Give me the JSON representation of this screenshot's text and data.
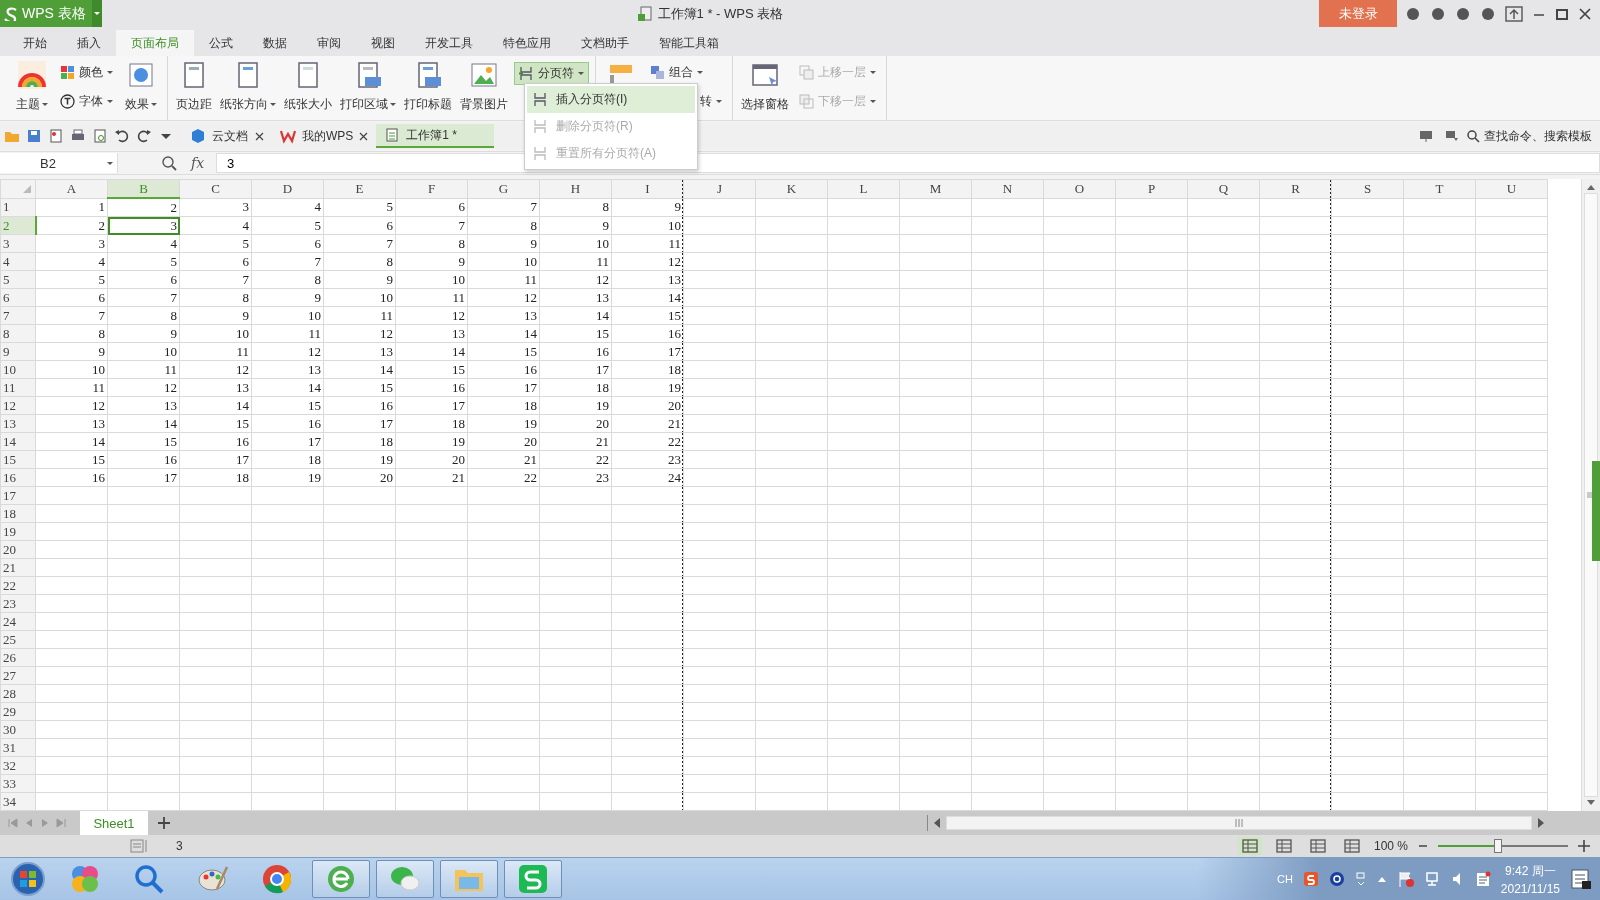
{
  "app_button": {
    "label": "WPS 表格"
  },
  "window": {
    "title": "工作簿1 * - WPS 表格"
  },
  "login_button": {
    "label": "未登录"
  },
  "ribbon_tabs": [
    {
      "label": "开始",
      "selected": false
    },
    {
      "label": "插入",
      "selected": false
    },
    {
      "label": "页面布局",
      "selected": true
    },
    {
      "label": "公式",
      "selected": false
    },
    {
      "label": "数据",
      "selected": false
    },
    {
      "label": "审阅",
      "selected": false
    },
    {
      "label": "视图",
      "selected": false
    },
    {
      "label": "开发工具",
      "selected": false
    },
    {
      "label": "特色应用",
      "selected": false
    },
    {
      "label": "文档助手",
      "selected": false
    },
    {
      "label": "智能工具箱",
      "selected": false
    }
  ],
  "ribbon": {
    "groups": [
      {
        "items": [
          {
            "kind": "large",
            "label": "主题",
            "dropdown": true
          },
          {
            "kind": "stack",
            "items": [
              {
                "label": "颜色",
                "dropdown": true,
                "disabled": false
              },
              {
                "label": "字体",
                "dropdown": true,
                "disabled": false
              }
            ]
          },
          {
            "kind": "large",
            "label": "效果",
            "dropdown": true
          }
        ]
      },
      {
        "items": [
          {
            "kind": "large",
            "label": "页边距",
            "dropdown": false
          },
          {
            "kind": "large",
            "label": "纸张方向",
            "dropdown": true
          },
          {
            "kind": "large",
            "label": "纸张大小",
            "dropdown": false
          },
          {
            "kind": "large",
            "label": "打印区域",
            "dropdown": true
          },
          {
            "kind": "large",
            "label": "打印标题",
            "dropdown": false
          },
          {
            "kind": "large",
            "label": "背景图片",
            "dropdown": false
          },
          {
            "kind": "stack",
            "items": [
              {
                "label": "分页符",
                "dropdown": true,
                "disabled": false,
                "pressed": true
              }
            ]
          }
        ]
      },
      {
        "items": [
          {
            "kind": "large"
          },
          {
            "kind": "stack",
            "items": [
              {
                "label": "组合",
                "dropdown": true,
                "disabled": false
              },
              {
                "label": "转",
                "dropdown": true,
                "disabled": false,
                "covered": true
              }
            ]
          }
        ]
      },
      {
        "items": [
          {
            "kind": "large",
            "label": "选择窗格",
            "dropdown": false
          },
          {
            "kind": "stack",
            "items": [
              {
                "label": "上移一层",
                "dropdown": true,
                "disabled": true
              },
              {
                "label": "下移一层",
                "dropdown": true,
                "disabled": true
              }
            ]
          }
        ]
      }
    ]
  },
  "dropdown_menu": {
    "items": [
      {
        "label": "插入分页符(I)",
        "disabled": false,
        "selected": true
      },
      {
        "label": "删除分页符(R)",
        "disabled": true,
        "selected": false
      },
      {
        "label": "重置所有分页符(A)",
        "disabled": true,
        "selected": false
      }
    ]
  },
  "doc_tabs": [
    {
      "label": "云文档",
      "closable": true,
      "selected": false
    },
    {
      "label": "我的WPS",
      "closable": true,
      "selected": false
    },
    {
      "label": "工作簿1 *",
      "closable": false,
      "selected": true
    }
  ],
  "search": {
    "label": "查找命令、搜索模板"
  },
  "formula_bar": {
    "name_box": "B2",
    "fx": "fx",
    "value": "3"
  },
  "sheet": {
    "columns": [
      {
        "label": "A",
        "selected": false,
        "page_break_after": false
      },
      {
        "label": "B",
        "selected": true,
        "page_break_after": false
      },
      {
        "label": "C",
        "selected": false,
        "page_break_after": false
      },
      {
        "label": "D",
        "selected": false,
        "page_break_after": false
      },
      {
        "label": "E",
        "selected": false,
        "page_break_after": false
      },
      {
        "label": "F",
        "selected": false,
        "page_break_after": false
      },
      {
        "label": "G",
        "selected": false,
        "page_break_after": false
      },
      {
        "label": "H",
        "selected": false,
        "page_break_after": false
      },
      {
        "label": "I",
        "selected": false,
        "page_break_after": true
      },
      {
        "label": "J",
        "selected": false,
        "page_break_after": false
      },
      {
        "label": "K",
        "selected": false,
        "page_break_after": false
      },
      {
        "label": "L",
        "selected": false,
        "page_break_after": false
      },
      {
        "label": "M",
        "selected": false,
        "page_break_after": false
      },
      {
        "label": "N",
        "selected": false,
        "page_break_after": false
      },
      {
        "label": "O",
        "selected": false,
        "page_break_after": false
      },
      {
        "label": "P",
        "selected": false,
        "page_break_after": false
      },
      {
        "label": "Q",
        "selected": false,
        "page_break_after": false
      },
      {
        "label": "R",
        "selected": false,
        "page_break_after": true
      },
      {
        "label": "S",
        "selected": false,
        "page_break_after": false
      },
      {
        "label": "T",
        "selected": false,
        "page_break_after": false
      },
      {
        "label": "U",
        "selected": false,
        "page_break_after": false
      }
    ],
    "rows": [
      {
        "header": "1",
        "selected": false,
        "cells": [
          "1",
          "2",
          "3",
          "4",
          "5",
          "6",
          "7",
          "8",
          "9"
        ]
      },
      {
        "header": "2",
        "selected": true,
        "cells": [
          "2",
          "3",
          "4",
          "5",
          "6",
          "7",
          "8",
          "9",
          "10"
        ]
      },
      {
        "header": "3",
        "selected": false,
        "cells": [
          "3",
          "4",
          "5",
          "6",
          "7",
          "8",
          "9",
          "10",
          "11"
        ]
      },
      {
        "header": "4",
        "selected": false,
        "cells": [
          "4",
          "5",
          "6",
          "7",
          "8",
          "9",
          "10",
          "11",
          "12"
        ]
      },
      {
        "header": "5",
        "selected": false,
        "cells": [
          "5",
          "6",
          "7",
          "8",
          "9",
          "10",
          "11",
          "12",
          "13"
        ]
      },
      {
        "header": "6",
        "selected": false,
        "cells": [
          "6",
          "7",
          "8",
          "9",
          "10",
          "11",
          "12",
          "13",
          "14"
        ]
      },
      {
        "header": "7",
        "selected": false,
        "cells": [
          "7",
          "8",
          "9",
          "10",
          "11",
          "12",
          "13",
          "14",
          "15"
        ]
      },
      {
        "header": "8",
        "selected": false,
        "cells": [
          "8",
          "9",
          "10",
          "11",
          "12",
          "13",
          "14",
          "15",
          "16"
        ]
      },
      {
        "header": "9",
        "selected": false,
        "cells": [
          "9",
          "10",
          "11",
          "12",
          "13",
          "14",
          "15",
          "16",
          "17"
        ]
      },
      {
        "header": "10",
        "selected": false,
        "cells": [
          "10",
          "11",
          "12",
          "13",
          "14",
          "15",
          "16",
          "17",
          "18"
        ]
      },
      {
        "header": "11",
        "selected": false,
        "cells": [
          "11",
          "12",
          "13",
          "14",
          "15",
          "16",
          "17",
          "18",
          "19"
        ]
      },
      {
        "header": "12",
        "selected": false,
        "cells": [
          "12",
          "13",
          "14",
          "15",
          "16",
          "17",
          "18",
          "19",
          "20"
        ]
      },
      {
        "header": "13",
        "selected": false,
        "cells": [
          "13",
          "14",
          "15",
          "16",
          "17",
          "18",
          "19",
          "20",
          "21"
        ]
      },
      {
        "header": "14",
        "selected": false,
        "cells": [
          "14",
          "15",
          "16",
          "17",
          "18",
          "19",
          "20",
          "21",
          "22"
        ]
      },
      {
        "header": "15",
        "selected": false,
        "cells": [
          "15",
          "16",
          "17",
          "18",
          "19",
          "20",
          "21",
          "22",
          "23"
        ]
      },
      {
        "header": "16",
        "selected": false,
        "cells": [
          "16",
          "17",
          "18",
          "19",
          "20",
          "21",
          "22",
          "23",
          "24"
        ]
      },
      {
        "header": "17",
        "selected": false
      },
      {
        "header": "18",
        "selected": false
      },
      {
        "header": "19",
        "selected": false
      },
      {
        "header": "20",
        "selected": false
      },
      {
        "header": "21",
        "selected": false
      },
      {
        "header": "22",
        "selected": false
      },
      {
        "header": "23",
        "selected": false
      },
      {
        "header": "24",
        "selected": false
      },
      {
        "header": "25",
        "selected": false
      },
      {
        "header": "26",
        "selected": false
      },
      {
        "header": "27",
        "selected": false
      },
      {
        "header": "28",
        "selected": false
      },
      {
        "header": "29",
        "selected": false
      },
      {
        "header": "30",
        "selected": false
      },
      {
        "header": "31",
        "selected": false
      },
      {
        "header": "32",
        "selected": false
      },
      {
        "header": "33",
        "selected": false
      },
      {
        "header": "34",
        "selected": false
      }
    ]
  },
  "sheet_tabs": [
    {
      "label": "Sheet1",
      "selected": true
    }
  ],
  "status_bar": {
    "value": "3",
    "zoom": "100 %",
    "zoom_slider": {
      "level": 0.45
    }
  },
  "taskbar": {
    "apps": [
      {
        "running": false
      },
      {
        "running": false
      },
      {
        "running": false
      },
      {
        "running": false
      },
      {
        "running": true
      },
      {
        "running": true
      },
      {
        "running": true
      },
      {
        "running": true
      }
    ],
    "language": "CH",
    "time": "9:42 周一",
    "date": "2021/11/15"
  }
}
